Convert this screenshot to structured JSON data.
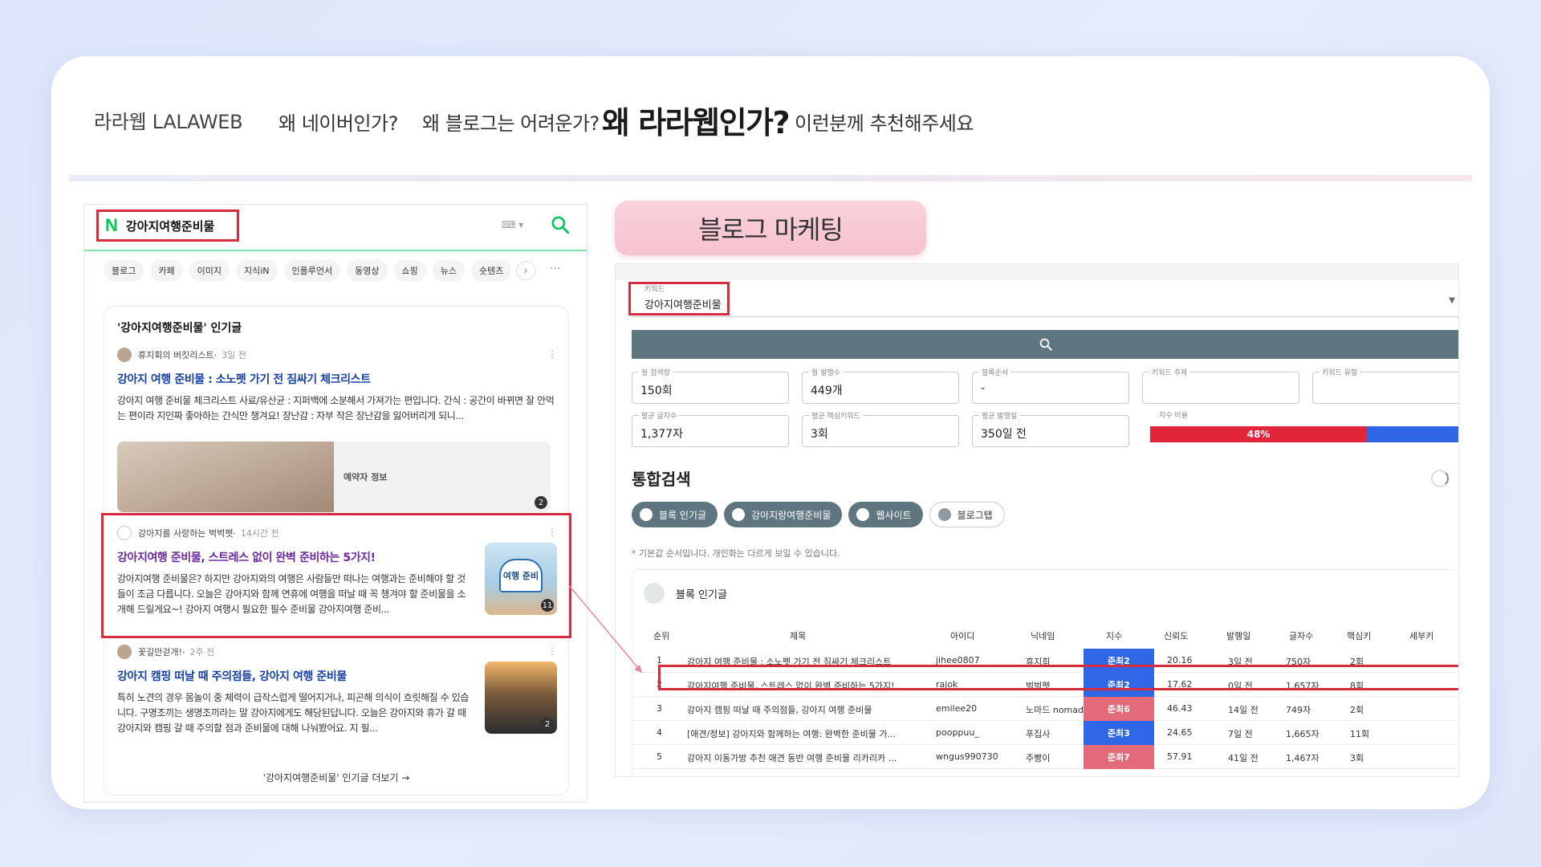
{
  "nav": {
    "brand": "라라웹 LALAWEB",
    "items": [
      "왜 네이버인가?",
      "왜 블로그는 어려운가?",
      "왜 라라웹인가?",
      "이런분께 추천해주세요"
    ],
    "active_index": 2
  },
  "naver": {
    "logo": "N",
    "query": "강아지여행준비물",
    "tabs": [
      "블로그",
      "카페",
      "이미지",
      "지식iN",
      "인플루언서",
      "동영상",
      "쇼핑",
      "뉴스",
      "숏텐츠"
    ],
    "panel_title": "'강아지여행준비물' 인기글",
    "posts": [
      {
        "author": "휴지회의 버킷리스트",
        "time": "3일 전",
        "title": "강아지 여행 준비물 : 소노펫 가기 전 짐싸기 체크리스트",
        "desc": "강아지 여행 준비물 체크리스트 사료/유산균 : 지퍼백에 소분해서 가져가는 편입니다. 간식 : 공간이 바뀌면 잘 안먹는 편이라 지인짜 좋아하는 간식만 챙겨요! 장난감 : 자부 작은 장난감을 잃어버리게 되니...",
        "thumb_info": "예약자 정보",
        "thumb_count": "2"
      },
      {
        "author": "강아지를 사랑하는 벅벅펫",
        "time": "14시간 전",
        "title": "강아지여행 준비물, 스트레스 없이 완벽 준비하는 5가지!",
        "desc": "강아지여행 준비물은? 하지만 강아지와의 여행은 사람들만 떠나는 여행과는 준비해야 할 것들이 조금 다릅니다. 오늘은 강아지와 함께 연휴에 여행을 떠날 때 꼭 챙겨야 할 준비물을 소개해 드릴게요~! 강아지 여행시 필요한 필수 준비물 강아지여행 준비...",
        "thumb_label": "여행 준비",
        "thumb_count": "11"
      },
      {
        "author": "꽃길만걷개!",
        "time": "2주 전",
        "title": "강아지 캠핑 떠날 때 주의점들, 강아지 여행 준비물",
        "desc": "특히 노견의 경우 몸놀이 중 체력이 급작스럽게 떨어지거나, 피곤해 의식이 흐릿해질 수 있습니다. 구명조끼는 생명조끼라는 말 강아지에게도 해당된답니다. 오늘은 강아지와 휴가 갈 때 강아지와 캠핑 갈 때 주의할 점과 준비물에 대해 나눠봤어요. 지 필...",
        "thumb_count": "2"
      }
    ],
    "footer": "'강아지여행준비물' 인기글 더보기 →"
  },
  "marketing": {
    "label": "블로그 마케팅",
    "keyword_caption": "키워드",
    "keyword_value": "강아지여행준비물",
    "fields_row1": [
      {
        "cap": "월 검색량",
        "val": "150회"
      },
      {
        "cap": "월 발행수",
        "val": "449개"
      },
      {
        "cap": "블록순서",
        "val": "-"
      },
      {
        "cap": "키워드 주제",
        "val": ""
      },
      {
        "cap": "키워드 유형",
        "val": ""
      }
    ],
    "fields_row2": [
      {
        "cap": "평균 글자수",
        "val": "1,377자"
      },
      {
        "cap": "평균 핵심키워드",
        "val": "3회"
      },
      {
        "cap": "평균 발행일",
        "val": "350일 전"
      }
    ],
    "ratio_caption": "지수 비율",
    "ratio_value": "48%",
    "ratio_fraction": 0.7,
    "section_title": "통합검색",
    "chips": [
      "블록 인기글",
      "강아지랑여행준비물",
      "웹사이트",
      "블로그탭"
    ],
    "note": "* 기본값 순서입니다. 개인화는 다르게 보일 수 있습니다.",
    "table_title": "블록 인기글",
    "columns": [
      "순위",
      "제목",
      "아이디",
      "닉네임",
      "지수",
      "신뢰도",
      "발행일",
      "글자수",
      "핵심키",
      "세부키"
    ],
    "rows": [
      {
        "rank": "1",
        "title": "강아지 여행 준비물 : 소노펫 가기 전 짐싸기 체크리스트",
        "id": "jihee0807_",
        "nick": "휴지희",
        "index": "준최2",
        "color": "#2f66e6",
        "trust": "20.16",
        "date": "3일 전",
        "chars": "750자",
        "core": "2회"
      },
      {
        "rank": "2",
        "title": "강아지여행 준비물, 스트레스 없이 완벽 준비하는 5가지!",
        "id": "rajok",
        "nick": "벅벅펫",
        "index": "준최2",
        "color": "#2f66e6",
        "trust": "17.62",
        "date": "0일 전",
        "chars": "1,657자",
        "core": "8회"
      },
      {
        "rank": "3",
        "title": "강아지 캠핑 떠날 때 주의점들, 강아지 여행 준비물",
        "id": "emilee20",
        "nick": "노마드 nomad",
        "index": "준최6",
        "color": "#e36a78",
        "trust": "46.43",
        "date": "14일 전",
        "chars": "749자",
        "core": "2회"
      },
      {
        "rank": "4",
        "title": "[애견/정보] 강아지와 함께하는 여행: 완벽한 준비물 가...",
        "id": "pooppuu_",
        "nick": "푸집사",
        "index": "준최3",
        "color": "#2f66e6",
        "trust": "24.65",
        "date": "7일 전",
        "chars": "1,665자",
        "core": "11회"
      },
      {
        "rank": "5",
        "title": "강아지 이동가방 추천 애견 동반 여행 준비물 리카리카 ...",
        "id": "wngus990730",
        "nick": "주빵이",
        "index": "준최7",
        "color": "#e36a78",
        "trust": "57.91",
        "date": "41일 전",
        "chars": "1,467자",
        "core": "3회"
      }
    ]
  },
  "colors": {
    "highlight": "#d62d3e",
    "naver_green": "#03c75a",
    "tool_slate": "#5f7680",
    "ratio_red": "#e3253a",
    "ratio_blue": "#2f66e6"
  }
}
